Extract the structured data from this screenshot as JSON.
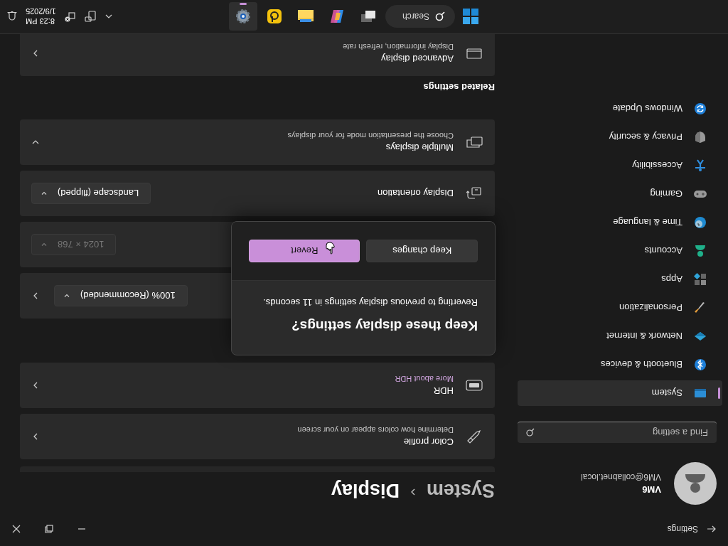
{
  "window": {
    "title": "Settings"
  },
  "profile": {
    "name": "VM6",
    "email": "VM6@collabnet.local"
  },
  "search": {
    "placeholder": "Find a setting"
  },
  "sidebar": {
    "items": [
      {
        "label": "System",
        "selected": true
      },
      {
        "label": "Bluetooth & devices",
        "selected": false
      },
      {
        "label": "Network & internet",
        "selected": false
      },
      {
        "label": "Personalization",
        "selected": false
      },
      {
        "label": "Apps",
        "selected": false
      },
      {
        "label": "Accounts",
        "selected": false
      },
      {
        "label": "Time & language",
        "selected": false
      },
      {
        "label": "Gaming",
        "selected": false
      },
      {
        "label": "Accessibility",
        "selected": false
      },
      {
        "label": "Privacy & security",
        "selected": false
      },
      {
        "label": "Windows Update",
        "selected": false
      }
    ]
  },
  "breadcrumb": [
    "System",
    "Display"
  ],
  "cards": [
    {
      "kind": "link",
      "title": "Color profile",
      "subtitle": "Determine how colors appear on your screen",
      "subtitle_link": false
    },
    {
      "kind": "link",
      "title": "HDR",
      "subtitle": "More about HDR",
      "subtitle_link": true
    },
    {
      "kind": "picker",
      "control": {
        "value": "100% (Recommended)",
        "disabled": false
      }
    },
    {
      "kind": "dropdown",
      "control": {
        "value": "1024 × 768",
        "disabled": true
      }
    },
    {
      "kind": "dropdown",
      "title": "Display orientation",
      "control": {
        "value": "Landscape (flipped)",
        "disabled": false
      }
    },
    {
      "kind": "expander",
      "title": "Multiple displays",
      "subtitle": "Choose the presentation mode for your displays",
      "subtitle_link": false,
      "expanded": false
    }
  ],
  "related": {
    "heading": "Related settings",
    "cards": [
      {
        "title": "Advanced display",
        "subtitle": "Display information, refresh rate"
      }
    ]
  },
  "dialog": {
    "title": "Keep these display settings?",
    "message": "Reverting to previous display settings in 11 seconds.",
    "buttons": [
      {
        "label": "Keep changes",
        "primary": false
      },
      {
        "label": "Revert",
        "primary": true
      }
    ]
  },
  "taskbar": {
    "search": "Search",
    "apps": [
      {
        "selected": false
      },
      {
        "selected": false
      },
      {
        "selected": false
      },
      {
        "selected": false
      },
      {
        "selected": true
      }
    ],
    "time": "8:23 PM",
    "date": "1/9/2025"
  }
}
